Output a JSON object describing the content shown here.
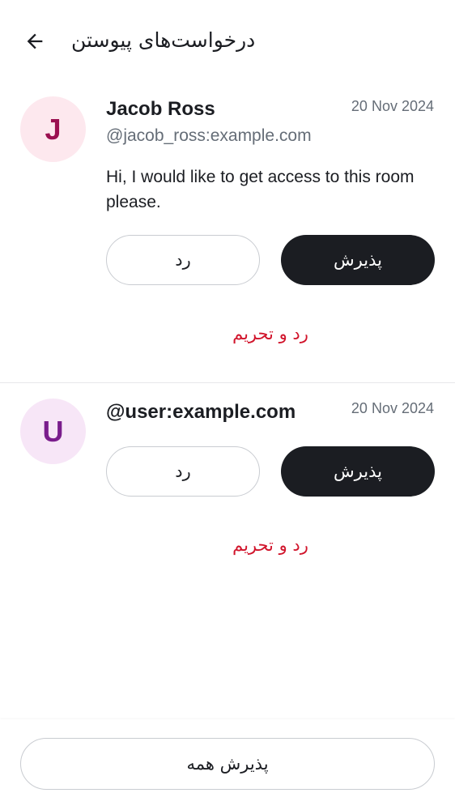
{
  "header": {
    "title": "درخواست‌های پیوستن",
    "back_icon": "arrow-left-icon"
  },
  "requests": [
    {
      "avatar_letter": "J",
      "avatar_bg": "#fde8ee",
      "avatar_fg": "#9b1050",
      "name": "Jacob Ross",
      "user_id": "@jacob_ross:example.com",
      "date": "20 Nov 2024",
      "message": "Hi, I would like to get access to this room please.",
      "decline_label": "رد",
      "accept_label": "پذیرش",
      "decline_ban_label": "رد و تحریم"
    },
    {
      "avatar_letter": "U",
      "avatar_bg": "#f7e6f7",
      "avatar_fg": "#7a1d8c",
      "name": "@user:example.com",
      "date": "20 Nov 2024",
      "decline_label": "رد",
      "accept_label": "پذیرش",
      "decline_ban_label": "رد و تحریم"
    }
  ],
  "footer": {
    "accept_all_label": "پذیرش همه"
  },
  "colors": {
    "accent_dark": "#1b1d22",
    "danger": "#d1142b",
    "secondary_text": "#656d77"
  }
}
